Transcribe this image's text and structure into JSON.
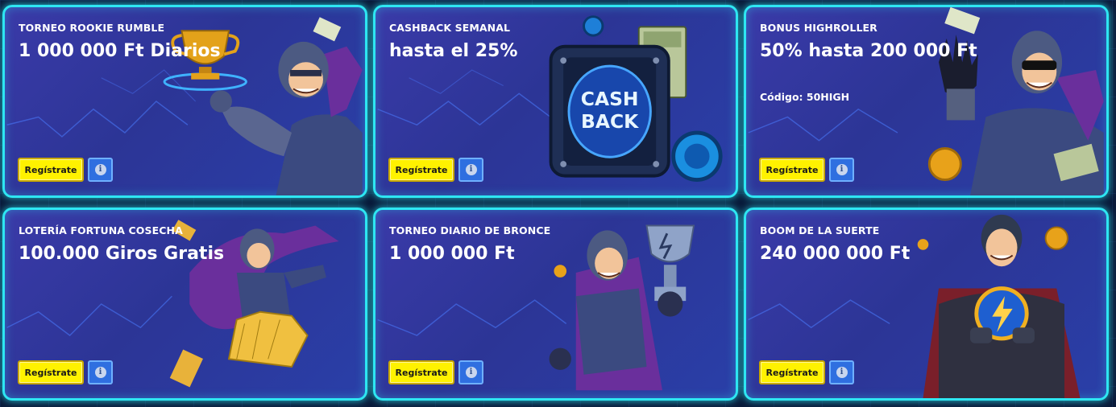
{
  "cards": [
    {
      "eyebrow": "TORNEO ROOKIE RUMBLE",
      "headline": "1 000 000 Ft Diarios",
      "code": "",
      "register_label": "Regístrate",
      "info_icon": "i",
      "art": "hero-with-gold-trophy"
    },
    {
      "eyebrow": "CASHBACK SEMANAL",
      "headline": "hasta el 25%",
      "code": "",
      "register_label": "Regístrate",
      "info_icon": "i",
      "art": "cashback-safe-with-money",
      "art_text": "CASH BACK"
    },
    {
      "eyebrow": "BONUS HIGHROLLER",
      "headline": "50% hasta 200 000 Ft",
      "code": "Código: 50HIGH",
      "register_label": "Regístrate",
      "info_icon": "i",
      "art": "hero-with-sunglasses-and-money"
    },
    {
      "eyebrow": "LOTERÍA FORTUNA COSECHA",
      "headline": "100.000 Giros Gratis",
      "code": "",
      "register_label": "Regístrate",
      "info_icon": "i",
      "art": "flying-hero-with-golden-tickets"
    },
    {
      "eyebrow": "TORNEO DIARIO DE BRONCE",
      "headline": "1 000 000 Ft",
      "code": "",
      "register_label": "Regístrate",
      "info_icon": "i",
      "art": "hero-with-silver-trophy"
    },
    {
      "eyebrow": "BOOM DE LA SUERTE",
      "headline": "240 000 000 Ft",
      "code": "",
      "register_label": "Regístrate",
      "info_icon": "i",
      "art": "hero-with-lightning-orb"
    }
  ],
  "colors": {
    "card_border": "#2ee6f2",
    "card_bg": "#2c3596",
    "register_button": "#fff200",
    "info_button": "#2f6fe0"
  }
}
